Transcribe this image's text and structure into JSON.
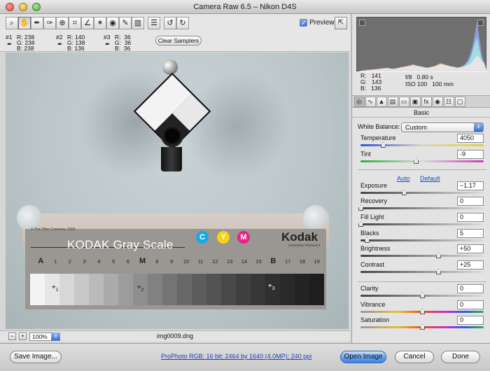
{
  "window": {
    "title": "Camera Raw 6.5  –  Nikon D4S"
  },
  "toolbar": {
    "tools": [
      {
        "name": "zoom-tool",
        "icon": "magnifier-icon",
        "glyph": "⌕"
      },
      {
        "name": "hand-tool",
        "icon": "hand-icon",
        "glyph": "✋",
        "selected": true
      },
      {
        "name": "white-balance-tool",
        "icon": "eyedropper-icon",
        "glyph": "✒"
      },
      {
        "name": "color-sampler-tool",
        "icon": "color-sampler-icon",
        "glyph": "✑"
      },
      {
        "name": "targeted-adjustment-tool",
        "icon": "target-adjust-icon",
        "glyph": "⊕"
      },
      {
        "name": "crop-tool",
        "icon": "crop-icon",
        "glyph": "⌗"
      },
      {
        "name": "straighten-tool",
        "icon": "straighten-icon",
        "glyph": "∠"
      },
      {
        "name": "spot-removal-tool",
        "icon": "spot-removal-icon",
        "glyph": "✶"
      },
      {
        "name": "red-eye-tool",
        "icon": "red-eye-icon",
        "glyph": "◉"
      },
      {
        "name": "adjustment-brush-tool",
        "icon": "brush-icon",
        "glyph": "✎"
      },
      {
        "name": "graduated-filter-tool",
        "icon": "graduated-filter-icon",
        "glyph": "▥"
      },
      {
        "name": "preferences-button",
        "icon": "list-icon",
        "glyph": "☰",
        "gap": true
      },
      {
        "name": "rotate-left-button",
        "icon": "rotate-left-icon",
        "glyph": "↺",
        "gap": true
      },
      {
        "name": "rotate-right-button",
        "icon": "rotate-right-icon",
        "glyph": "↻"
      }
    ],
    "preview_label": "Preview",
    "preview_checked": true
  },
  "samplers": [
    {
      "label": "#1",
      "r": "R: 238",
      "g": "G: 238",
      "b": "B: 238"
    },
    {
      "label": "#2",
      "r": "R: 140",
      "g": "G: 138",
      "b": "B: 136"
    },
    {
      "label": "#3",
      "r": "R:  36",
      "g": "G:  36",
      "b": "B:  36"
    }
  ],
  "clear_samplers_label": "Clear Samplers",
  "image": {
    "copyright": "© The Tiffen Company, 2000",
    "card_title": "KODAK Gray Scale",
    "cmy": [
      "C",
      "Y",
      "M"
    ],
    "logo": "Kodak",
    "logo_sub": "LICENSED PRODUCT",
    "scale_labels": [
      "A",
      "1",
      "2",
      "3",
      "4",
      "5",
      "6",
      "M",
      "8",
      "9",
      "10",
      "11",
      "12",
      "13",
      "14",
      "15",
      "B",
      "17",
      "18",
      "19"
    ],
    "patch_colors": [
      "#f4f4f4",
      "#e6e6e6",
      "#d7d7d7",
      "#c8c8c8",
      "#bababa",
      "#ababab",
      "#9d9d9d",
      "#8e8e8e",
      "#818181",
      "#747474",
      "#686868",
      "#5d5d5d",
      "#525252",
      "#484848",
      "#3f3f3f",
      "#373737",
      "#2f2f2f",
      "#292929",
      "#232323",
      "#1e1e1e"
    ],
    "sampler_marks": [
      "1",
      "2",
      "3"
    ]
  },
  "status": {
    "zoom": "100%",
    "filename": "img0009.dng",
    "zoom_out": "−",
    "zoom_in": "+"
  },
  "histogram": {
    "bins_red": [
      2,
      3,
      3,
      4,
      4,
      5,
      5,
      6,
      6,
      7,
      7,
      8,
      7,
      6,
      6,
      7,
      8,
      9,
      10,
      11,
      12,
      13,
      14,
      12,
      11,
      10,
      9,
      8,
      8,
      9,
      10,
      12,
      14,
      16,
      15,
      13,
      12,
      10,
      9,
      8,
      7,
      8,
      9,
      10,
      12,
      14,
      18,
      24,
      30,
      26,
      20,
      16
    ],
    "bins_green": [
      2,
      3,
      3,
      4,
      4,
      4,
      5,
      5,
      6,
      6,
      7,
      7,
      7,
      6,
      6,
      7,
      8,
      9,
      9,
      10,
      11,
      12,
      13,
      12,
      11,
      10,
      9,
      8,
      8,
      9,
      10,
      11,
      13,
      15,
      14,
      13,
      12,
      11,
      10,
      9,
      8,
      9,
      10,
      12,
      16,
      22,
      34,
      50,
      62,
      40,
      22,
      14
    ],
    "bins_blue": [
      1,
      2,
      3,
      3,
      4,
      4,
      4,
      5,
      5,
      6,
      6,
      7,
      7,
      6,
      6,
      6,
      7,
      8,
      9,
      10,
      10,
      11,
      12,
      11,
      10,
      10,
      9,
      8,
      8,
      9,
      9,
      10,
      12,
      14,
      13,
      12,
      11,
      10,
      10,
      9,
      8,
      9,
      11,
      14,
      20,
      30,
      44,
      66,
      90,
      60,
      30,
      16
    ]
  },
  "readout": {
    "r": "R:   141",
    "g": "G:   143",
    "b": "B:   136",
    "aperture": "f/8",
    "shutter": "0.80 s",
    "iso": "ISO 100",
    "focal": "100 mm"
  },
  "panel_tabs": [
    {
      "name": "tab-basic",
      "icon": "aperture-icon",
      "glyph": "◎",
      "selected": true
    },
    {
      "name": "tab-tone-curve",
      "icon": "curve-icon",
      "glyph": "∿"
    },
    {
      "name": "tab-detail",
      "icon": "mountain-icon",
      "glyph": "▲"
    },
    {
      "name": "tab-hsl",
      "icon": "hsl-icon",
      "glyph": "▤"
    },
    {
      "name": "tab-split-toning",
      "icon": "split-tone-icon",
      "glyph": "▭"
    },
    {
      "name": "tab-lens",
      "icon": "lens-icon",
      "glyph": "▣"
    },
    {
      "name": "tab-effects",
      "icon": "fx-icon",
      "glyph": "fx"
    },
    {
      "name": "tab-camera-calibration",
      "icon": "camera-icon",
      "glyph": "◉"
    },
    {
      "name": "tab-presets",
      "icon": "presets-icon",
      "glyph": "☷"
    },
    {
      "name": "tab-snapshots",
      "icon": "snapshot-icon",
      "glyph": "▢"
    }
  ],
  "panel": {
    "section": "Basic",
    "white_balance_label": "White Balance:",
    "white_balance_value": "Custom",
    "auto_label": "Auto",
    "default_label": "Default"
  },
  "sliders": [
    {
      "name": "temperature",
      "label": "Temperature",
      "value": "4050",
      "level": 0.18,
      "track": "temp"
    },
    {
      "name": "tint",
      "label": "Tint",
      "value": "-9",
      "level": 0.45,
      "track": "tint"
    },
    {
      "name": "exposure",
      "label": "Exposure",
      "value": "−1.17",
      "level": 0.35,
      "track": "gray"
    },
    {
      "name": "recovery",
      "label": "Recovery",
      "value": "0",
      "level": 0.0,
      "track": "gray"
    },
    {
      "name": "fill-light",
      "label": "Fill Light",
      "value": "0",
      "level": 0.0,
      "track": "gray"
    },
    {
      "name": "blacks",
      "label": "Blacks",
      "value": "5",
      "level": 0.05,
      "track": "gray"
    },
    {
      "name": "brightness",
      "label": "Brightness",
      "value": "+50",
      "level": 0.63,
      "track": "gray"
    },
    {
      "name": "contrast",
      "label": "Contrast",
      "value": "+25",
      "level": 0.63,
      "track": "gray"
    },
    {
      "name": "clarity",
      "label": "Clarity",
      "value": "0",
      "level": 0.5,
      "track": "gray"
    },
    {
      "name": "vibrance",
      "label": "Vibrance",
      "value": "0",
      "level": 0.5,
      "track": "vib"
    },
    {
      "name": "saturation",
      "label": "Saturation",
      "value": "0",
      "level": 0.5,
      "track": "sat"
    }
  ],
  "bottom": {
    "save_label": "Save Image...",
    "workflow_label": "ProPhoto RGB; 16 bit; 2464 by 1640 (4.0MP); 240 ppi",
    "open_label": "Open Image",
    "cancel_label": "Cancel",
    "done_label": "Done"
  }
}
